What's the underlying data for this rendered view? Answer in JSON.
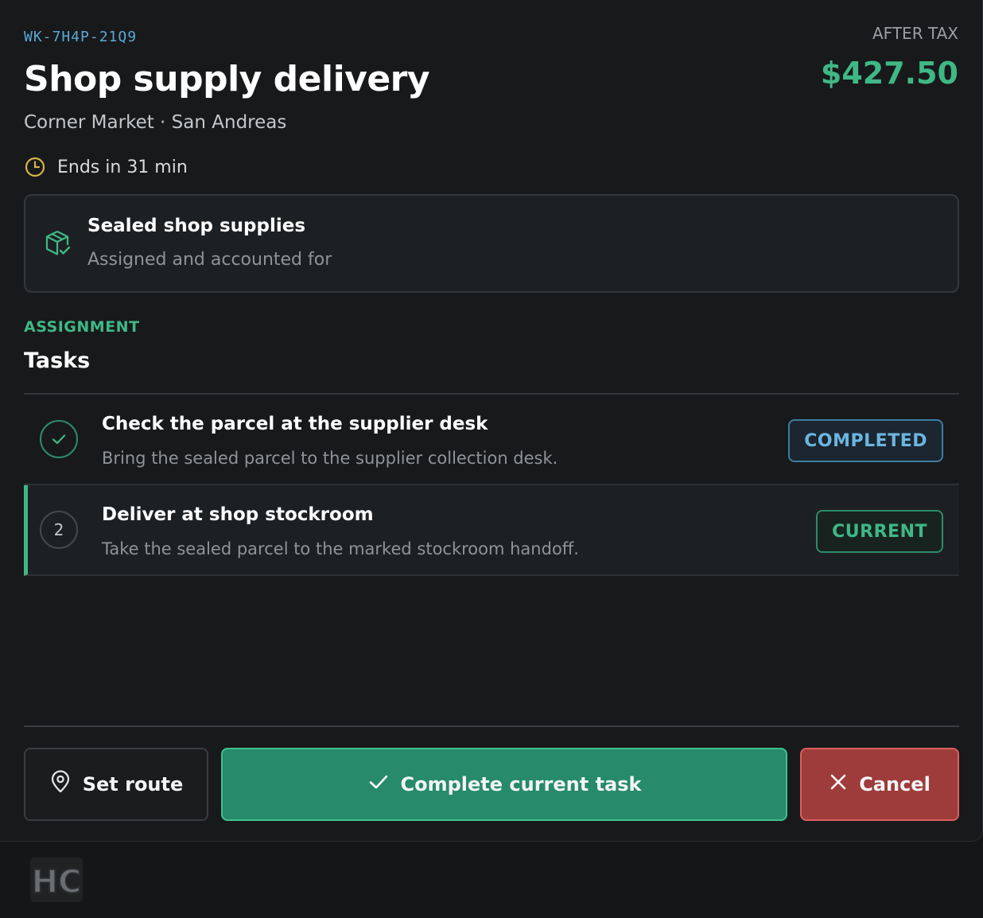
{
  "job": {
    "id": "WK-7H4P-21Q9",
    "title": "Shop supply delivery",
    "subtitle": "Corner Market · San Andreas",
    "tax_label": "AFTER TAX",
    "price": "$427.50",
    "timer": "Ends in 31 min"
  },
  "cargo": {
    "title": "Sealed shop supplies",
    "subtitle": "Assigned and accounted for",
    "icon": "package-check-icon"
  },
  "section": {
    "label": "ASSIGNMENT",
    "title": "Tasks"
  },
  "tasks": [
    {
      "marker": "check-icon",
      "title": "Check the parcel at the supplier desk",
      "description": "Bring the sealed parcel to the supplier collection desk.",
      "status": "COMPLETED"
    },
    {
      "marker": "2",
      "title": "Deliver at shop stockroom",
      "description": "Take the sealed parcel to the marked stockroom handoff.",
      "status": "CURRENT"
    }
  ],
  "actions": {
    "route_label": "Set route",
    "complete_label": "Complete current task",
    "cancel_label": "Cancel"
  },
  "logo_text": "HC",
  "colors": {
    "accent_green": "#3fb885",
    "completed_blue": "#6cb5e0",
    "cancel_red": "#9e3c3b",
    "timer_yellow": "#d4b44a"
  }
}
